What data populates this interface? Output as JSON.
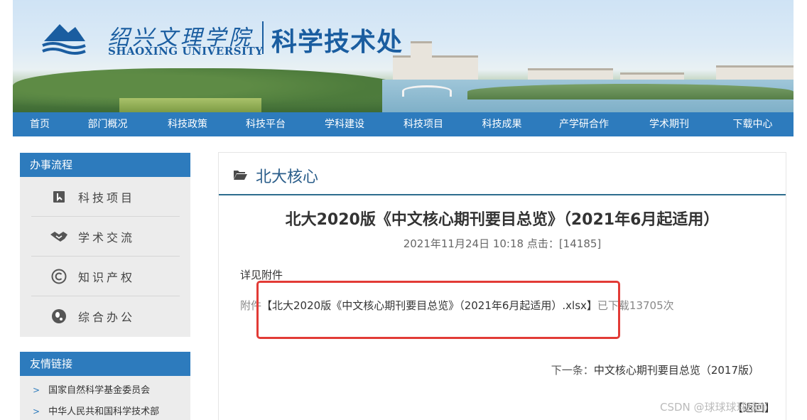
{
  "header": {
    "logo_cn": "绍兴文理学院",
    "logo_en": "SHAOXING UNIVERSITY",
    "dept_title": "科学技术处"
  },
  "nav": {
    "items": [
      "首页",
      "部门概况",
      "科技政策",
      "科技平台",
      "学科建设",
      "科技项目",
      "科技成果",
      "产学研合作",
      "学术期刊",
      "下载中心"
    ]
  },
  "sidebar": {
    "process_title": "办事流程",
    "process_items": [
      {
        "label": "科技项目",
        "icon": "bookmark-icon"
      },
      {
        "label": "学术交流",
        "icon": "handshake-icon"
      },
      {
        "label": "知识产权",
        "icon": "copyright-icon"
      },
      {
        "label": "综合办公",
        "icon": "office-icon"
      }
    ],
    "links_title": "友情链接",
    "links": [
      "国家自然科学基金委员会",
      "中华人民共和国科学技术部"
    ]
  },
  "main": {
    "section_title": "北大核心",
    "article_title": "北大2020版《中文核心期刊要目总览》（2021年6月起适用）",
    "meta": "2021年11月24日 10:18  点击：[14185]",
    "body": "详见附件",
    "attachment_prefix": "附件",
    "attachment_file": "【北大2020版《中文核心期刊要目总览》（2021年6月起适用）.xlsx】",
    "attachment_downloads": "已下载13705次",
    "next_label": "下一条：",
    "next_title": "中文核心期刊要目总览（2017版）",
    "back": "【返回】"
  },
  "watermark": "CSDN @球球球球球吖",
  "colors": {
    "nav_blue": "#2d7bbd",
    "highlight_red": "#e23b36",
    "title_blue": "#2a5d8a"
  }
}
